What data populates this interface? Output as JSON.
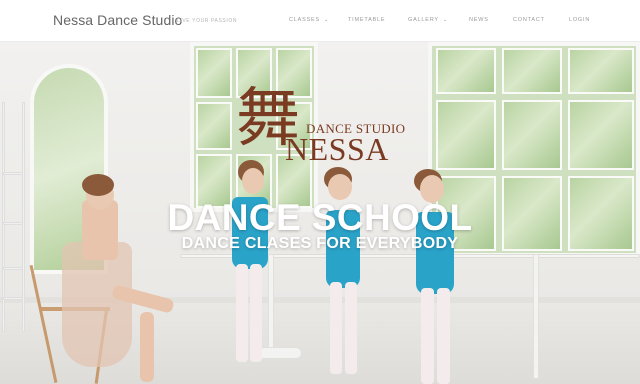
{
  "header": {
    "brand": "Nessa Dance Studio",
    "tagline": "LIVE YOUR PASSION"
  },
  "nav": [
    {
      "label": "CLASSES",
      "has_dropdown": true
    },
    {
      "label": "TIMETABLE",
      "has_dropdown": false
    },
    {
      "label": "GALLERY",
      "has_dropdown": true
    },
    {
      "label": "NEWS",
      "has_dropdown": false
    },
    {
      "label": "CONTACT",
      "has_dropdown": false
    },
    {
      "label": "LOGIN",
      "has_dropdown": false
    }
  ],
  "dropdown_glyph": "⌄",
  "logo": {
    "glyph": "舞",
    "top_text": "DANCE STUDIO",
    "main_text": "NESSA"
  },
  "hero": {
    "title": "DANCE SCHOOL",
    "subtitle": "DANCE CLASES FOR EVERYBODY"
  },
  "colors": {
    "logo": "#7a3b22",
    "leotard": "#2aa3c9"
  }
}
